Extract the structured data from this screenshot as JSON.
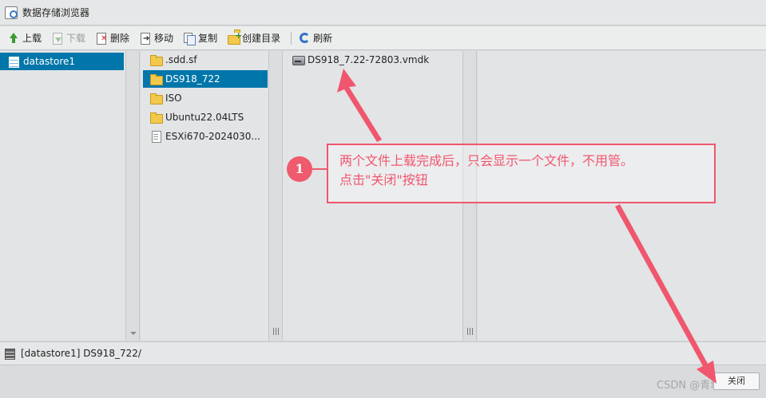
{
  "window": {
    "title": "数据存储浏览器"
  },
  "toolbar": {
    "upload": "上载",
    "download": "下载",
    "delete": "删除",
    "move": "移动",
    "copy": "复制",
    "create_dir": "创建目录",
    "refresh": "刷新"
  },
  "datastores": [
    {
      "label": "datastore1",
      "selected": true
    }
  ],
  "folders": [
    {
      "label": ".sdd.sf",
      "type": "folder"
    },
    {
      "label": "DS918_722",
      "type": "folder",
      "selected": true
    },
    {
      "label": "ISO",
      "type": "folder"
    },
    {
      "label": "Ubuntu22.04LTS",
      "type": "folder"
    },
    {
      "label": "ESXi670-2024030...",
      "type": "file"
    }
  ],
  "files": [
    {
      "label": "DS918_7.22-72803.vmdk",
      "type": "disk"
    }
  ],
  "status": {
    "path": "[datastore1] DS918_722/"
  },
  "footer": {
    "close_label": "关闭"
  },
  "annotation": {
    "badge": "1",
    "line1": "两个文件上载完成后，只会显示一个文件，不用管。",
    "line2": "点击\"关闭\"按钮",
    "color": "#f0566e"
  },
  "watermark": "CSDN @青城CC",
  "colors": {
    "selection": "#0076aa",
    "accent": "#f0566e"
  }
}
